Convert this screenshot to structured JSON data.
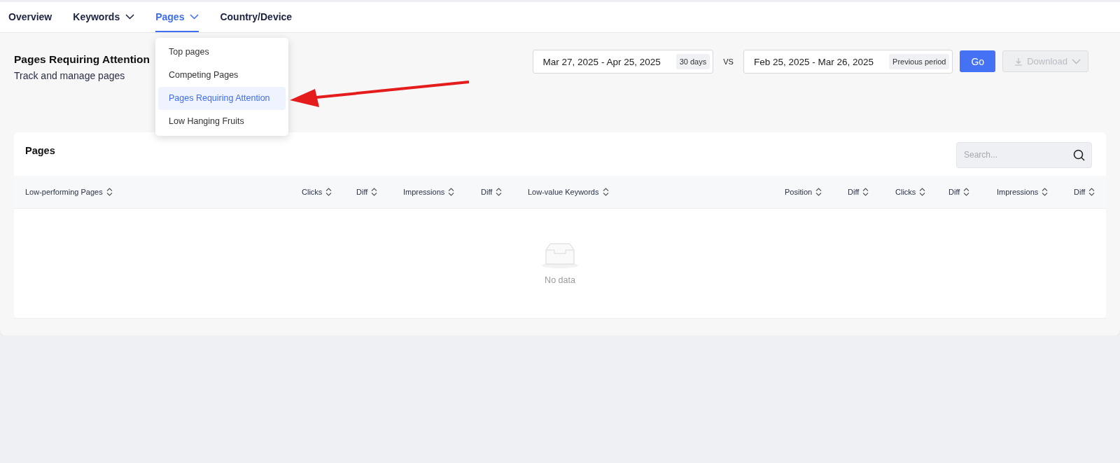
{
  "nav": {
    "tabs": [
      {
        "label": "Overview",
        "has_menu": false,
        "selected": false
      },
      {
        "label": "Keywords",
        "has_menu": true,
        "selected": false
      },
      {
        "label": "Pages",
        "has_menu": true,
        "selected": true
      },
      {
        "label": "Country/Device",
        "has_menu": false,
        "selected": false
      }
    ]
  },
  "pages_menu": {
    "items": [
      {
        "label": "Top pages",
        "selected": false
      },
      {
        "label": "Competing Pages",
        "selected": false
      },
      {
        "label": "Pages Requiring Attention",
        "selected": true
      },
      {
        "label": "Low Hanging Fruits",
        "selected": false
      }
    ]
  },
  "header": {
    "title": "Pages Requiring Attention",
    "subtitle": "Track and manage pages"
  },
  "date_range": {
    "value": "Mar 27, 2025 - Apr 25, 2025",
    "badge": "30 days"
  },
  "vs_label": "VS",
  "compare_range": {
    "value": "Feb 25, 2025 - Mar 26, 2025",
    "badge": "Previous period"
  },
  "go_button": "Go",
  "download_button": {
    "label": "Download",
    "disabled": true
  },
  "table": {
    "title": "Pages",
    "search": {
      "placeholder": "Search..."
    },
    "columns": [
      "Low-performing Pages",
      "Clicks",
      "Diff",
      "Impressions",
      "Diff",
      "Low-value Keywords",
      "Position",
      "Diff",
      "Clicks",
      "Diff",
      "Impressions",
      "Diff"
    ],
    "empty_text": "No data"
  }
}
